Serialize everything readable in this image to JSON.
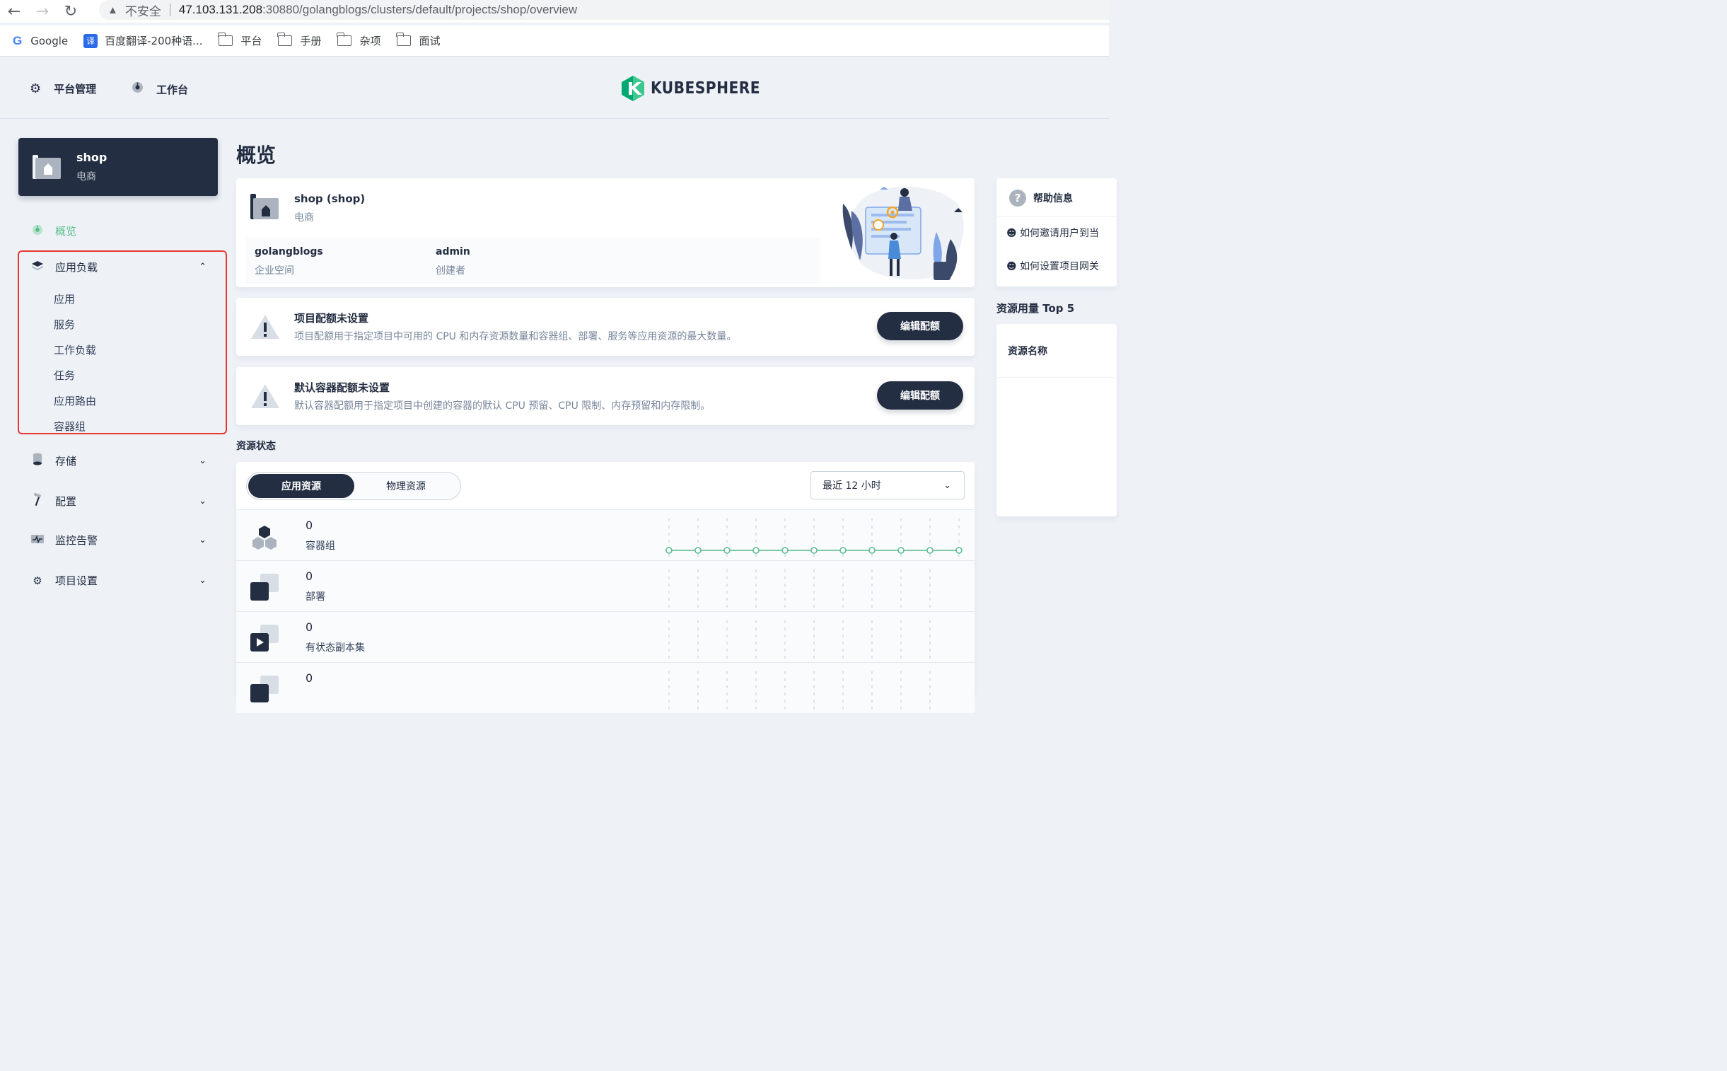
{
  "browser": {
    "insecure_label": "不安全",
    "url_host": "47.103.131.208",
    "url_path": ":30880/golangblogs/clusters/default/projects/shop/overview",
    "bookmarks": [
      {
        "label": "Google",
        "icon": "google-icon"
      },
      {
        "label": "百度翻译-200种语...",
        "icon": "translate-icon"
      },
      {
        "label": "平台",
        "icon": "folder-icon"
      },
      {
        "label": "手册",
        "icon": "folder-icon"
      },
      {
        "label": "杂项",
        "icon": "folder-icon"
      },
      {
        "label": "面试",
        "icon": "folder-icon"
      }
    ]
  },
  "header": {
    "platform_label": "平台管理",
    "workbench_label": "工作台",
    "logo_text": "KUBESPHERE"
  },
  "project": {
    "name": "shop",
    "alias": "电商"
  },
  "sidebar": {
    "overview": "概览",
    "workloads_group": "应用负载",
    "workloads_items": [
      "应用",
      "服务",
      "工作负载",
      "任务",
      "应用路由",
      "容器组"
    ],
    "storage": "存储",
    "config": "配置",
    "monitoring": "监控告警",
    "settings": "项目设置"
  },
  "main": {
    "title": "概览",
    "info": {
      "title": "shop (shop)",
      "subtitle": "电商",
      "workspace_value": "golangblogs",
      "workspace_label": "企业空间",
      "creator_value": "admin",
      "creator_label": "创建者"
    },
    "quota": {
      "title": "项目配额未设置",
      "desc": "项目配额用于指定项目中可用的 CPU 和内存资源数量和容器组、部署、服务等应用资源的最大数量。",
      "button": "编辑配额"
    },
    "default_quota": {
      "title": "默认容器配额未设置",
      "desc": "默认容器配额用于指定项目中创建的容器的默认 CPU 预留、CPU 限制、内存预留和内存限制。",
      "button": "编辑配额"
    },
    "resource_status": {
      "label": "资源状态",
      "tab_app": "应用资源",
      "tab_physical": "物理资源",
      "time_range": "最近 12 小时",
      "rows": [
        {
          "value": "0",
          "label": "容器组"
        },
        {
          "value": "0",
          "label": "部署"
        },
        {
          "value": "0",
          "label": "有状态副本集"
        },
        {
          "value": "0",
          "label": ""
        }
      ]
    }
  },
  "right": {
    "help_title": "帮助信息",
    "help_links": [
      "如何邀请用户到当",
      "如何设置项目网关"
    ],
    "top5_label": "资源用量 Top 5",
    "top5_header": "资源名称"
  },
  "colors": {
    "dark": "#242e42",
    "accent_green": "#55bc8a",
    "highlight_red": "#e8392f"
  }
}
